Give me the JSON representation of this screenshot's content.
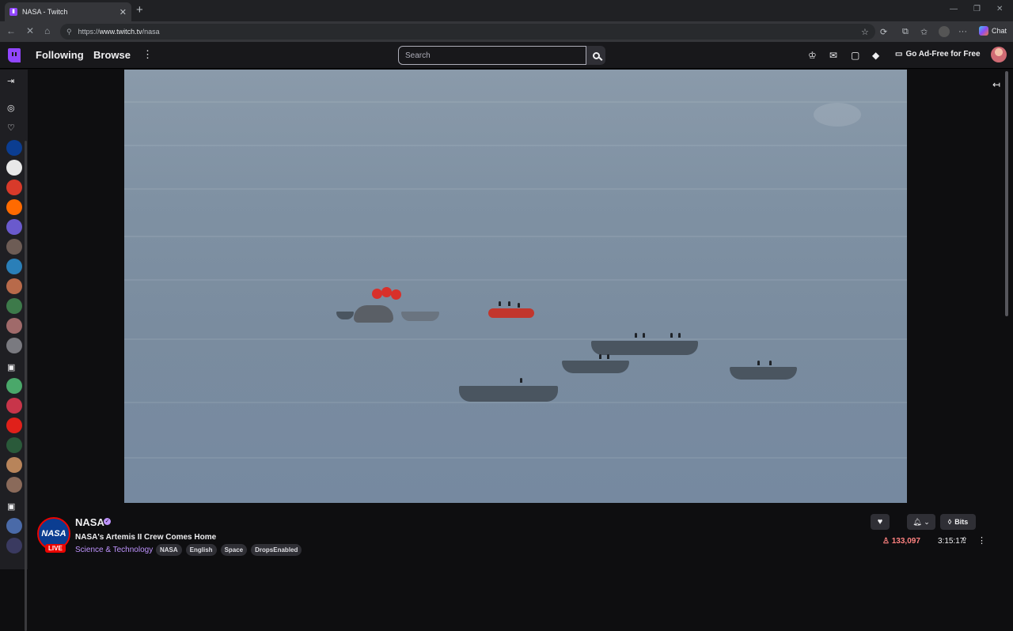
{
  "browser": {
    "tab_title": "NASA - Twitch",
    "tab_close": "✕",
    "new_tab": "+",
    "url_prefix": "https://",
    "url_host": "www.twitch.tv",
    "url_path": "/nasa",
    "chat_label": "Chat"
  },
  "topnav": {
    "following": "Following",
    "browse": "Browse",
    "more": "⋮",
    "search_placeholder": "Search",
    "ad_free": "Go Ad-Free for Free"
  },
  "channel": {
    "name": "NASA",
    "avatar_text": "NASA",
    "live_label": "LIVE",
    "title": "NASA's Artemis II Crew Comes Home",
    "category": "Science & Technology",
    "tags": [
      "NASA",
      "English",
      "Space",
      "DropsEnabled"
    ],
    "viewers": "133,097",
    "uptime": "3:15:17",
    "bits_label": "Bits"
  },
  "colors": {
    "twitch_purple": "#9146ff",
    "live_red": "#eb0400",
    "viewer_red": "#ff8280",
    "category_purple": "#bf94ff"
  }
}
